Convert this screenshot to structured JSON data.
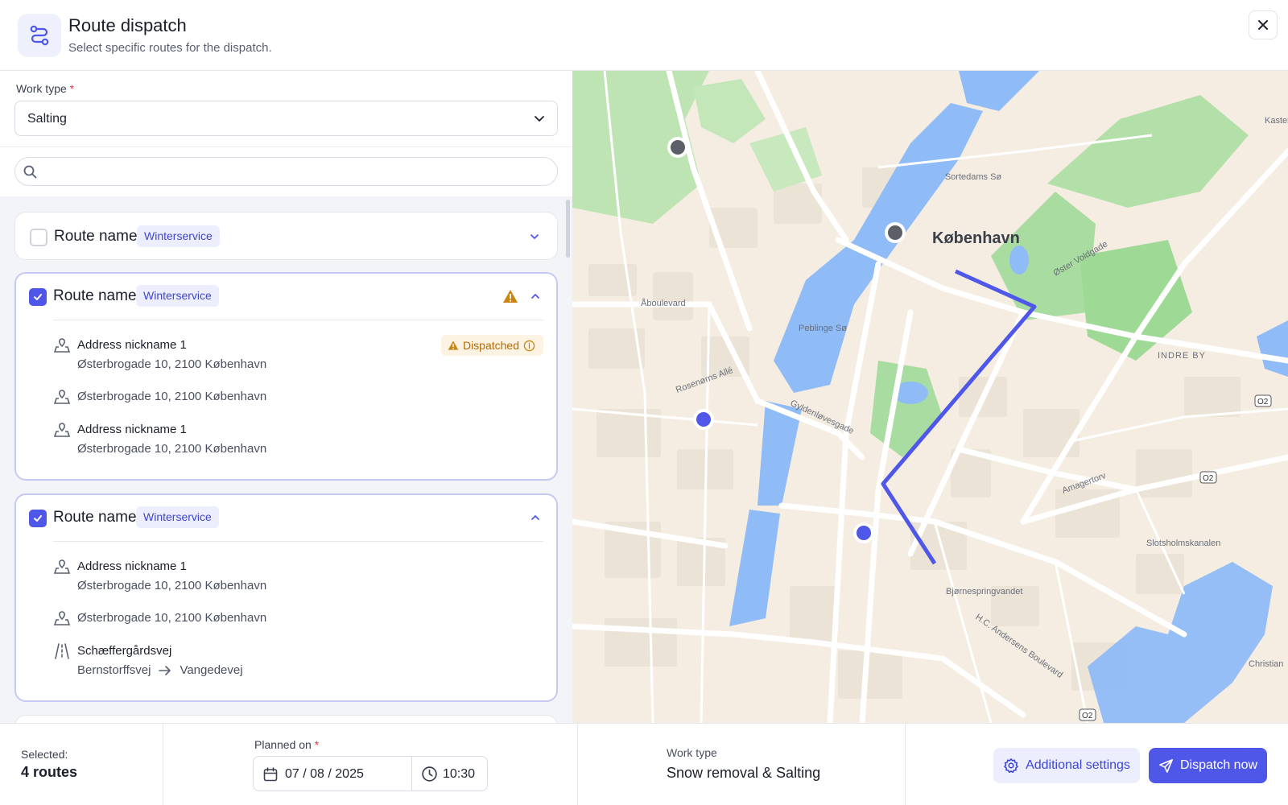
{
  "header": {
    "title": "Route dispatch",
    "subtitle": "Select specific routes for the dispatch."
  },
  "filters": {
    "work_type_label": "Work type",
    "required_mark": "*",
    "work_type_value": "Salting",
    "search_placeholder": ""
  },
  "routes": [
    {
      "name": "Route name",
      "tag": "Winterservice",
      "checked": false,
      "expanded": false
    },
    {
      "name": "Route name",
      "tag": "Winterservice",
      "checked": true,
      "expanded": true,
      "warning": true,
      "stops": [
        {
          "nickname": "Address nickname 1",
          "address": "Østerbrogade 10, 2100 København",
          "status": "Dispatched"
        },
        {
          "nickname": "",
          "address": "Østerbrogade 10, 2100 København"
        },
        {
          "nickname": "Address nickname 1",
          "address": "Østerbrogade 10, 2100 København"
        }
      ]
    },
    {
      "name": "Route name",
      "tag": "Winterservice",
      "checked": true,
      "expanded": true,
      "stops": [
        {
          "nickname": "Address nickname 1",
          "address": "Østerbrogade 10, 2100 København"
        },
        {
          "nickname": "",
          "address": "Østerbrogade 10, 2100 København"
        }
      ],
      "road_segment": {
        "name": "Schæffergårdsvej",
        "from": "Bernstorffsvej",
        "to": "Vangedevej"
      }
    }
  ],
  "map": {
    "city_label": "København",
    "labels": {
      "lake1": "Sortedams Sø",
      "lake2": "Peblinge Sø",
      "district": "INDRE BY",
      "canal": "Slotsholmskanalen",
      "water2": "Bjørnespringvandet",
      "street1": "Rosenørns Allé",
      "street2": "Gyldenløvesgade",
      "street3": "Åboulevard",
      "street4": "Øster Voldgade",
      "street5": "Amagertorv",
      "street6": "H.C. Andersens Boulevard",
      "street7": "Christian",
      "street8": "Kastel",
      "badge": "O2"
    },
    "route_color": "#4f57e8"
  },
  "footer": {
    "selected_label": "Selected:",
    "selected_value": "4 routes",
    "planned_label": "Planned on",
    "date": "07 / 08 / 2025",
    "time": "10:30",
    "work_type_label": "Work type",
    "work_type_value": "Snow removal & Salting",
    "settings_button": "Additional settings",
    "dispatch_button": "Dispatch now"
  }
}
